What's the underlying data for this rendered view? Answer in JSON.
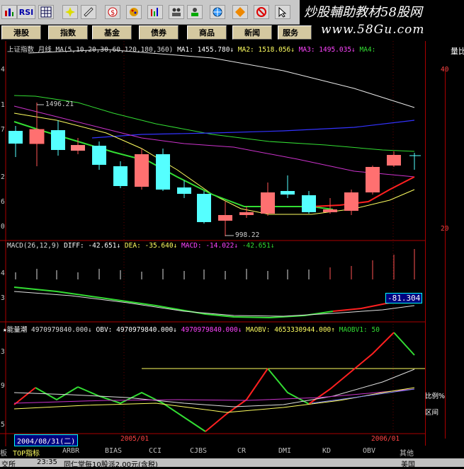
{
  "toolbar": {
    "rsi_label": "RSI",
    "icons": [
      "chart-icon",
      "rsi-icon",
      "grid-icon",
      "lines-icon",
      "cross-icon",
      "ruler-icon",
      "brush-icon",
      "dollar-icon",
      "palette-icon",
      "bars-icon",
      "people-icon",
      "people-chart-icon",
      "globe-icon",
      "tool-icon",
      "star-icon",
      "diamond-icon",
      "bell-icon",
      "no-icon",
      "cursor-icon",
      "calendar-icon"
    ]
  },
  "watermark": {
    "line1": "炒股輔助教材58股网",
    "line2": "www.58Gu.com"
  },
  "menu": [
    "港股",
    "指数",
    "基金",
    "债券",
    "商品",
    "新闻",
    "服务"
  ],
  "main_panel": {
    "title": "上证指数 月线",
    "ma_params": "MA(5,10,20,30,60,120,180,360)",
    "ma1": "MA1: 1455.780↓",
    "ma2": "MA2: 1518.056↓",
    "ma3": "MA3: 1495.035↓",
    "ma4": "MA4:",
    "high_label": "1496.21",
    "low_label": "998.22",
    "left_ticks": [
      "4",
      "1",
      "7",
      "2",
      "6",
      "0"
    ]
  },
  "macd_panel": {
    "title": "MACD(26,12,9)",
    "diff": "DIFF: -42.651↓",
    "dea": "DEA: -35.640↓",
    "macd": "MACD: -14.022↓",
    "extra": "-42.651↓",
    "current": "-81.304",
    "left_ticks": [
      "4",
      "3"
    ]
  },
  "obv_panel": {
    "title": "★能量潮",
    "v1": "4970979840.000↓",
    "v2": "OBV: 4970979840.000↓",
    "v3": "4970979840.000↓",
    "maobv": "MAOBV: 4653330944.000↑",
    "maobv1": "MAOBV1: 50",
    "left_ticks": [
      "3",
      "9",
      "5"
    ]
  },
  "right_panel": {
    "header": "量比",
    "val_top": "40",
    "val_mid": "20",
    "ratio_label": "比例%",
    "range_label": "区间"
  },
  "x_axis": {
    "date_selected": "2004/08/31(二)",
    "label_2005": "2005/01",
    "label_2006": "2006/01"
  },
  "bottom_tabs": [
    "板",
    "TOP指标",
    "ARBR",
    "BIAS",
    "CCI",
    "CJBS",
    "CR",
    "DMI",
    "KD",
    "OBV",
    "其他"
  ],
  "status": {
    "left": "交所",
    "time": "23:35",
    "news": "同仁堂每10股派2.00元(含税)",
    "right": "美国"
  },
  "colors": {
    "up_candle": "#ff5555",
    "down_candle": "#55ffff",
    "ma_white": "#e8e8e8",
    "ma_yellow": "#ffff60",
    "ma_magenta": "#cc33cc",
    "ma_green": "#33dd33",
    "ma_blue": "#3333ff",
    "grid_red": "#aa0000"
  }
}
